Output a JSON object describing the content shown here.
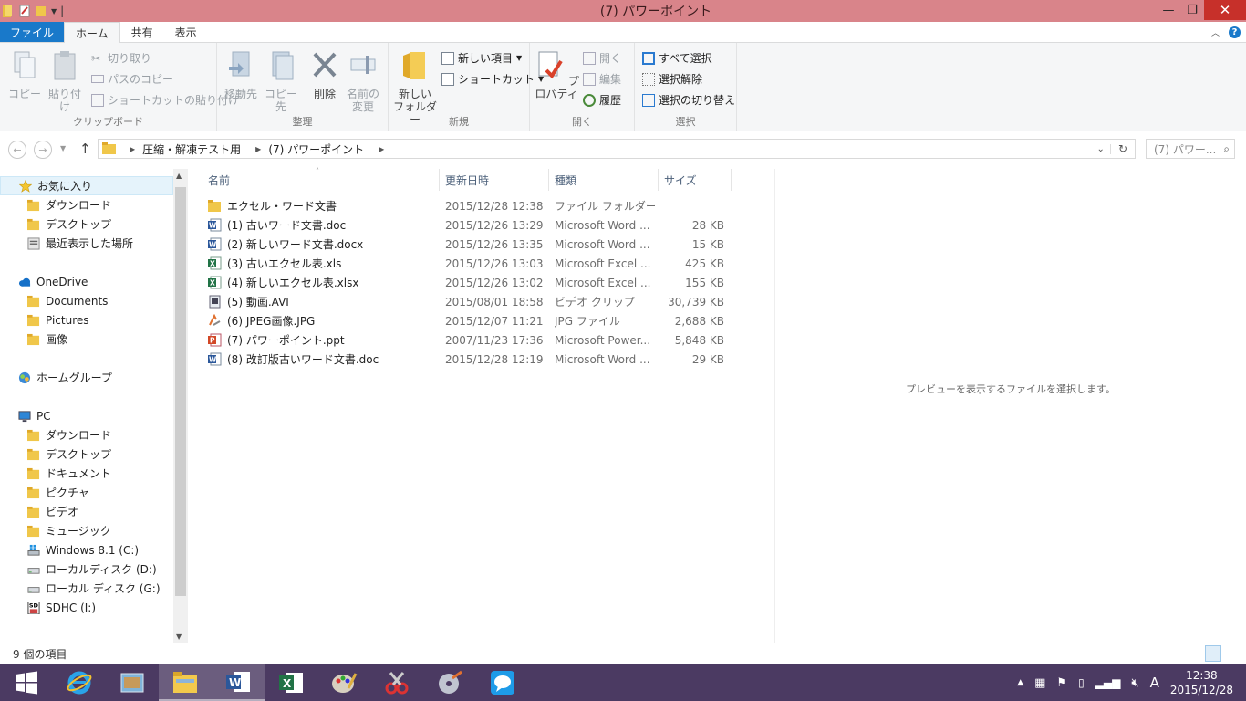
{
  "window": {
    "title": "(7) パワーポイント"
  },
  "ribbon_tabs": [
    "ファイル",
    "ホーム",
    "共有",
    "表示"
  ],
  "ribbon": {
    "clipboard": {
      "copy": "コピー",
      "paste": "貼り付け",
      "cut": "切り取り",
      "copy_path": "パスのコピー",
      "paste_shortcut": "ショートカットの貼り付け",
      "label": "クリップボード"
    },
    "organize": {
      "move_to": "移動先",
      "copy_to": "コピー先",
      "delete": "削除",
      "rename_l1": "名前の",
      "rename_l2": "変更",
      "label": "整理"
    },
    "new": {
      "new_folder_l1": "新しい",
      "new_folder_l2": "フォルダー",
      "new_item": "新しい項目",
      "shortcut": "ショートカット",
      "label": "新規"
    },
    "open": {
      "properties": "プロパティ",
      "open": "開く",
      "edit": "編集",
      "history": "履歴",
      "label": "開く"
    },
    "select": {
      "select_all": "すべて選択",
      "select_none": "選択解除",
      "invert": "選択の切り替え",
      "label": "選択"
    }
  },
  "address": {
    "crumbs": [
      "圧縮・解凍テスト用",
      "(7) パワーポイント"
    ],
    "search_placeholder": "(7) パワー..."
  },
  "nav": [
    {
      "label": "お気に入り",
      "icon": "star-icon",
      "indent": 0,
      "selected": true
    },
    {
      "label": "ダウンロード",
      "icon": "folder-icon",
      "indent": 1
    },
    {
      "label": "デスクトップ",
      "icon": "folder-icon",
      "indent": 1
    },
    {
      "label": "最近表示した場所",
      "icon": "recent-icon",
      "indent": 1
    },
    {
      "label": "",
      "gap": true
    },
    {
      "label": "OneDrive",
      "icon": "cloud-icon",
      "indent": 0
    },
    {
      "label": "Documents",
      "icon": "folder-icon",
      "indent": 1
    },
    {
      "label": "Pictures",
      "icon": "folder-icon",
      "indent": 1
    },
    {
      "label": "画像",
      "icon": "folder-icon",
      "indent": 1
    },
    {
      "label": "",
      "gap": true
    },
    {
      "label": "ホームグループ",
      "icon": "homegroup-icon",
      "indent": 0
    },
    {
      "label": "",
      "gap": true
    },
    {
      "label": "PC",
      "icon": "pc-icon",
      "indent": 0
    },
    {
      "label": "ダウンロード",
      "icon": "folder-icon",
      "indent": 1
    },
    {
      "label": "デスクトップ",
      "icon": "folder-icon",
      "indent": 1
    },
    {
      "label": "ドキュメント",
      "icon": "folder-icon",
      "indent": 1
    },
    {
      "label": "ピクチャ",
      "icon": "folder-icon",
      "indent": 1
    },
    {
      "label": "ビデオ",
      "icon": "folder-icon",
      "indent": 1
    },
    {
      "label": "ミュージック",
      "icon": "folder-icon",
      "indent": 1
    },
    {
      "label": "Windows 8.1 (C:)",
      "icon": "drive-windows-icon",
      "indent": 1
    },
    {
      "label": "ローカルディスク (D:)",
      "icon": "drive-icon",
      "indent": 1
    },
    {
      "label": "ローカル ディスク (G:)",
      "icon": "drive-icon",
      "indent": 1
    },
    {
      "label": "SDHC (I:)",
      "icon": "sd-card-icon",
      "indent": 1
    }
  ],
  "columns": [
    "名前",
    "更新日時",
    "種類",
    "サイズ"
  ],
  "files": [
    {
      "name": "エクセル・ワード文書",
      "date": "2015/12/28 12:38",
      "type": "ファイル フォルダー",
      "size": "",
      "icon": "folder-icon"
    },
    {
      "name": "(1) 古いワード文書.doc",
      "date": "2015/12/26 13:29",
      "type": "Microsoft Word ...",
      "size": "28 KB",
      "icon": "word-file-icon"
    },
    {
      "name": "(2) 新しいワード文書.docx",
      "date": "2015/12/26 13:35",
      "type": "Microsoft Word ...",
      "size": "15 KB",
      "icon": "word-file-icon"
    },
    {
      "name": "(3) 古いエクセル表.xls",
      "date": "2015/12/26 13:03",
      "type": "Microsoft Excel ...",
      "size": "425 KB",
      "icon": "excel-file-icon"
    },
    {
      "name": "(4) 新しいエクセル表.xlsx",
      "date": "2015/12/26 13:02",
      "type": "Microsoft Excel ...",
      "size": "155 KB",
      "icon": "excel-file-icon"
    },
    {
      "name": "(5) 動画.AVI",
      "date": "2015/08/01 18:58",
      "type": "ビデオ クリップ",
      "size": "30,739 KB",
      "icon": "video-file-icon"
    },
    {
      "name": "(6)  JPEG画像.JPG",
      "date": "2015/12/07 11:21",
      "type": "JPG ファイル",
      "size": "2,688 KB",
      "icon": "image-file-icon"
    },
    {
      "name": "(7) パワーポイント.ppt",
      "date": "2007/11/23 17:36",
      "type": "Microsoft Power...",
      "size": "5,848 KB",
      "icon": "powerpoint-file-icon"
    },
    {
      "name": "(8) 改訂版古いワード文書.doc",
      "date": "2015/12/28 12:19",
      "type": "Microsoft Word ...",
      "size": "29 KB",
      "icon": "word-file-icon"
    }
  ],
  "preview_text": "プレビューを表示するファイルを選択します。",
  "status": {
    "count": "9 個の項目"
  },
  "taskbar": {
    "apps": [
      "windows-start-icon",
      "internet-explorer-icon",
      "app-icon",
      "file-explorer-icon",
      "word-icon",
      "excel-icon",
      "paint-icon",
      "snipping-icon",
      "media-icon",
      "messenger-icon"
    ],
    "ime": "A",
    "time": "12:38",
    "date": "2015/12/28"
  },
  "colors": {
    "titlebar": "#d9848a",
    "file_tab": "#1979ca",
    "taskbar": "#4b3a62",
    "close": "#c7302a"
  }
}
